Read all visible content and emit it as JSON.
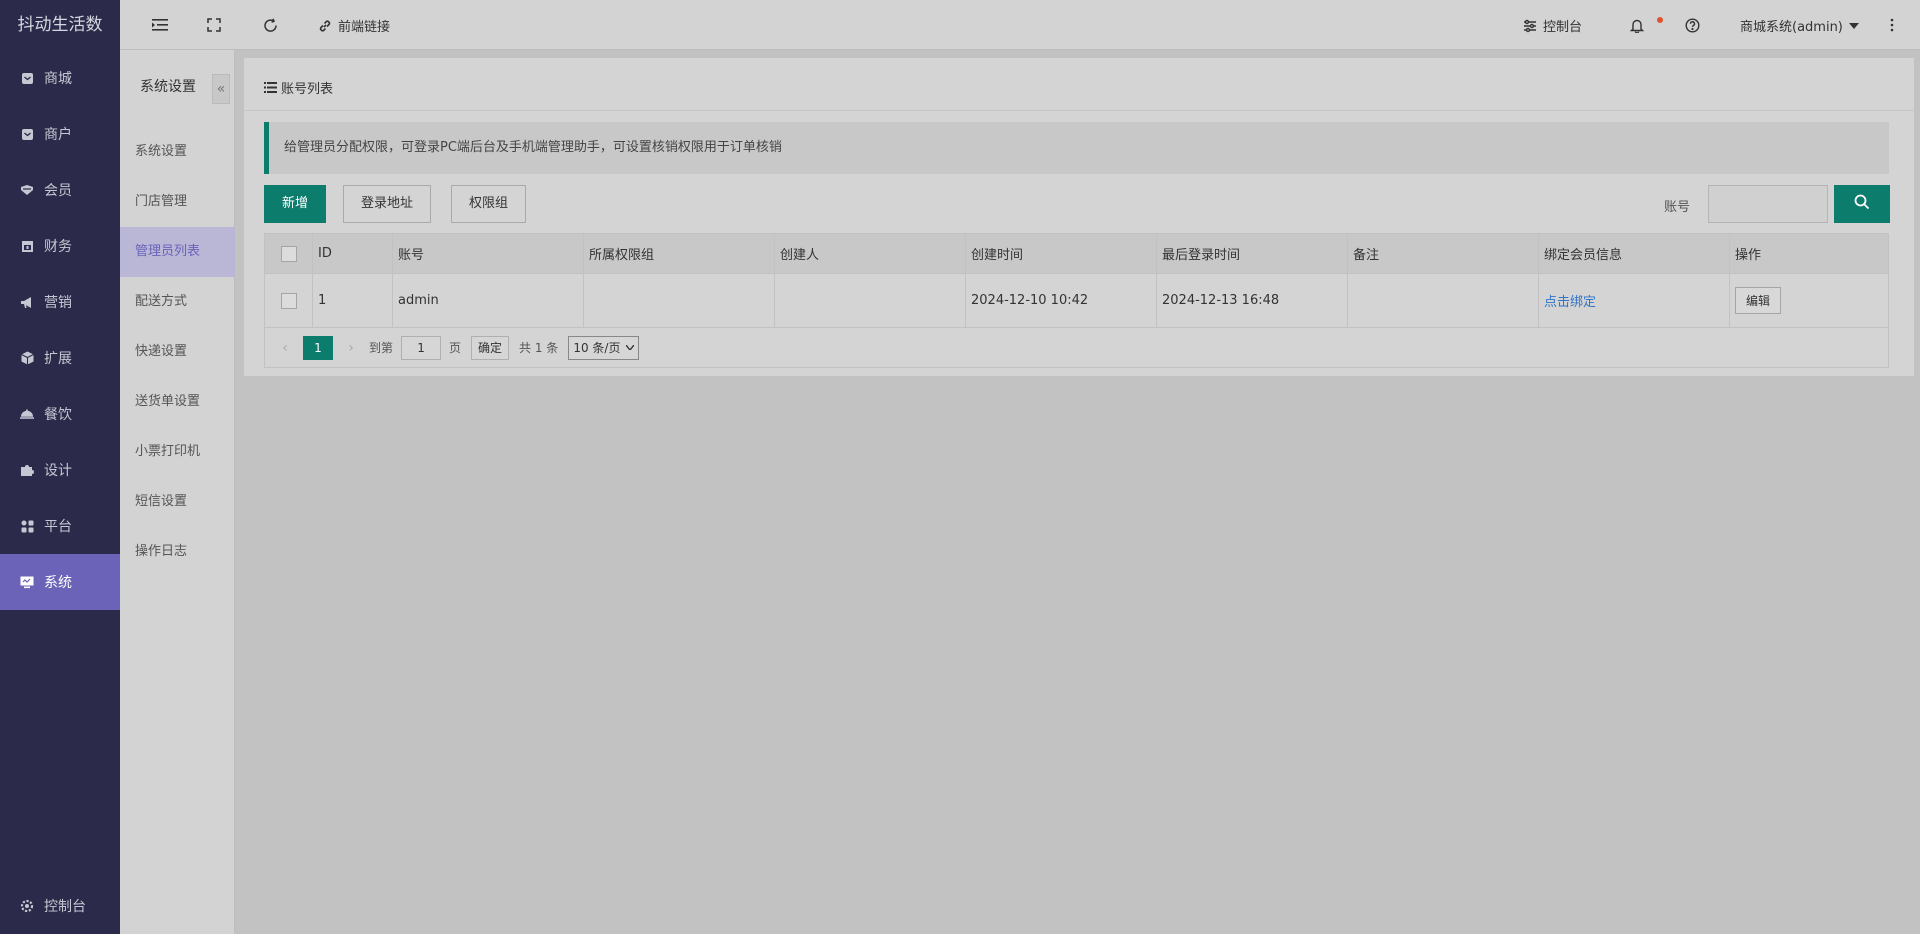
{
  "brand": "抖动生活数",
  "sidebar": {
    "items": [
      {
        "label": "商城",
        "icon": "store-icon"
      },
      {
        "label": "商户",
        "icon": "merchant-icon"
      },
      {
        "label": "会员",
        "icon": "member-icon"
      },
      {
        "label": "财务",
        "icon": "finance-icon"
      },
      {
        "label": "营销",
        "icon": "megaphone-icon"
      },
      {
        "label": "扩展",
        "icon": "cube-icon"
      },
      {
        "label": "餐饮",
        "icon": "dish-icon"
      },
      {
        "label": "设计",
        "icon": "puzzle-icon"
      },
      {
        "label": "平台",
        "icon": "grid-icon"
      },
      {
        "label": "系统",
        "icon": "monitor-icon"
      }
    ],
    "active": "系统",
    "bottom_label": "控制台"
  },
  "subnav": {
    "title": "系统设置",
    "items": [
      "系统设置",
      "门店管理",
      "管理员列表",
      "配送方式",
      "快递设置",
      "送货单设置",
      "小票打印机",
      "短信设置",
      "操作日志"
    ],
    "active": "管理员列表"
  },
  "header": {
    "frontend_link": "前端链接",
    "console": "控制台",
    "user": "商城系统(admin)"
  },
  "panel": {
    "title": "账号列表",
    "notice": "给管理员分配权限，可登录PC端后台及手机端管理助手，可设置核销权限用于订单核销",
    "buttons": {
      "add": "新增",
      "login_url": "登录地址",
      "perm_group": "权限组"
    },
    "search_label": "账号"
  },
  "table": {
    "columns": [
      "ID",
      "账号",
      "所属权限组",
      "创建人",
      "创建时间",
      "最后登录时间",
      "备注",
      "绑定会员信息",
      "操作"
    ],
    "rows": [
      {
        "id": "1",
        "account": "admin",
        "group": "",
        "creator": "",
        "created": "2024-12-10 10:42",
        "last_login": "2024-12-13 16:48",
        "note": "",
        "bind": "点击绑定",
        "action": "编辑"
      }
    ]
  },
  "pager": {
    "current": "1",
    "goto_prefix": "到第",
    "goto_value": "1",
    "goto_suffix": "页",
    "confirm": "确定",
    "total": "共 1 条",
    "page_size": "10 条/页"
  },
  "colors": {
    "accent": "#0c7c6d",
    "sidebar": "#2b2a4a",
    "active": "#6a63b8"
  }
}
